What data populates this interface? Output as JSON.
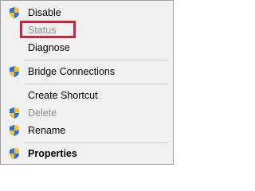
{
  "menu": {
    "items": [
      {
        "label": "Disable",
        "state": "enabled",
        "icon": "shield-icon"
      },
      {
        "label": "Status",
        "state": "disabled",
        "icon": ""
      },
      {
        "label": "Diagnose",
        "state": "enabled",
        "icon": ""
      },
      {
        "label": "Bridge Connections",
        "state": "enabled",
        "icon": "shield-icon"
      },
      {
        "label": "Create Shortcut",
        "state": "enabled",
        "icon": ""
      },
      {
        "label": "Delete",
        "state": "disabled",
        "icon": "shield-icon"
      },
      {
        "label": "Rename",
        "state": "enabled",
        "icon": "shield-icon"
      },
      {
        "label": "Properties",
        "state": "enabled",
        "icon": "shield-icon",
        "bold": true
      }
    ]
  },
  "colors": {
    "menu_bg": "#f0f0f0",
    "disabled_text": "#8d8d8d",
    "highlight": "#d2233c",
    "shield_blue": "#2f6fd6",
    "shield_yellow": "#f2c230"
  }
}
